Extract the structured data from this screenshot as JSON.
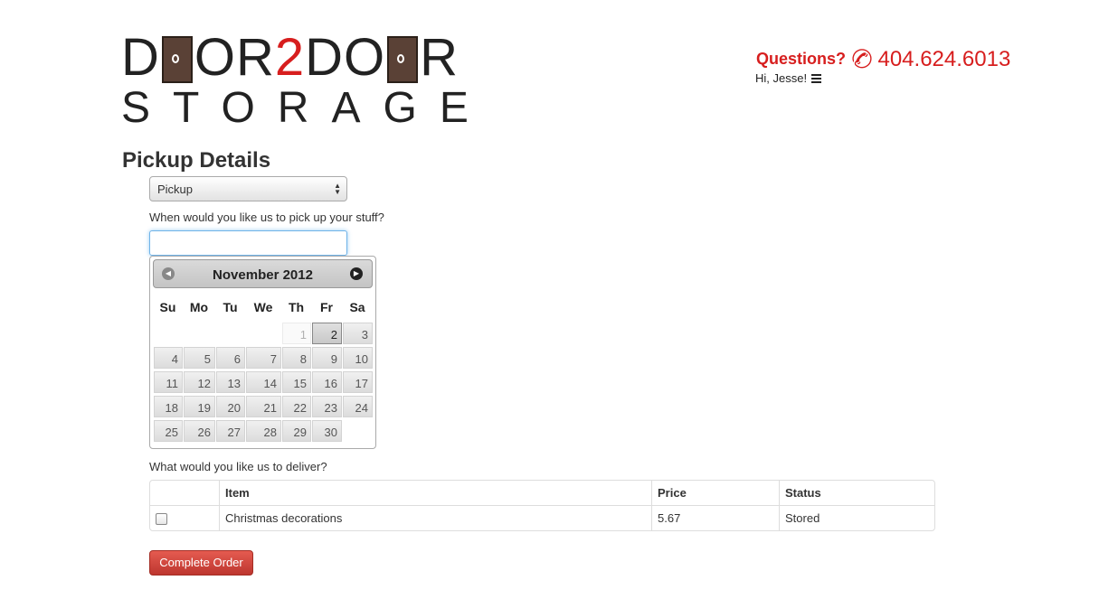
{
  "logo": {
    "line1_a": "D",
    "line1_b": "OR",
    "line1_2": "2",
    "line1_c": "DO",
    "line1_d": "R",
    "line2": "STORAGE"
  },
  "header": {
    "questions_label": "Questions?",
    "phone": "404.624.6013",
    "greeting": "Hi, Jesse!"
  },
  "page_title": "Pickup Details",
  "type_select": {
    "value": "Pickup"
  },
  "pickup_question": "When would you like us to pick up your stuff?",
  "date_input": {
    "value": ""
  },
  "datepicker": {
    "month_year": "November 2012",
    "days_of_week": [
      "Su",
      "Mo",
      "Tu",
      "We",
      "Th",
      "Fr",
      "Sa"
    ],
    "selected_day": "2",
    "disabled_day": "1",
    "days": [
      "1",
      "2",
      "3",
      "4",
      "5",
      "6",
      "7",
      "8",
      "9",
      "10",
      "11",
      "12",
      "13",
      "14",
      "15",
      "16",
      "17",
      "18",
      "19",
      "20",
      "21",
      "22",
      "23",
      "24",
      "25",
      "26",
      "27",
      "28",
      "29",
      "30"
    ]
  },
  "deliver_question": "What would you like us to deliver?",
  "table": {
    "headers": [
      "",
      "Item",
      "Price",
      "Status"
    ],
    "rows": [
      {
        "item": "Christmas decorations",
        "price": "5.67",
        "status": "Stored"
      }
    ]
  },
  "complete_button": "Complete Order",
  "colors": {
    "brand_red": "#d71e1e",
    "door_brown": "#5a4136",
    "button_red": "#bd362f"
  }
}
